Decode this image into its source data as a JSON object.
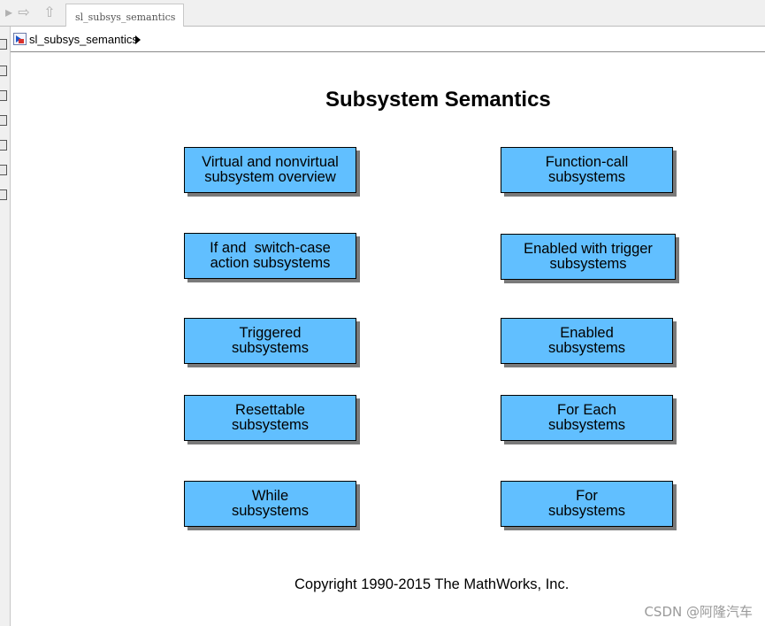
{
  "tab": {
    "title": "sl_subsys_semantics"
  },
  "breadcrumb": {
    "model_name": "sl_subsys_semantics"
  },
  "canvas": {
    "title": "Subsystem Semantics",
    "blocks": [
      {
        "line1": "Virtual and nonvirtual",
        "line2": "subsystem overview"
      },
      {
        "line1": "Function-call",
        "line2": "subsystems"
      },
      {
        "line1": "If and  switch-case",
        "line2": "action subsystems"
      },
      {
        "line1": "Enabled with trigger",
        "line2": "subsystems"
      },
      {
        "line1": "Triggered",
        "line2": "subsystems"
      },
      {
        "line1": "Enabled",
        "line2": "subsystems"
      },
      {
        "line1": "Resettable",
        "line2": "subsystems"
      },
      {
        "line1": "For Each",
        "line2": "subsystems"
      },
      {
        "line1": "While",
        "line2": "subsystems"
      },
      {
        "line1": "For",
        "line2": "subsystems"
      }
    ],
    "copyright": "Copyright 1990-2015 The MathWorks, Inc."
  },
  "watermark": "CSDN @阿隆汽车",
  "colors": {
    "block_fill": "#61bfff",
    "block_border": "#000000",
    "block_shadow": "#7a7a7a"
  }
}
